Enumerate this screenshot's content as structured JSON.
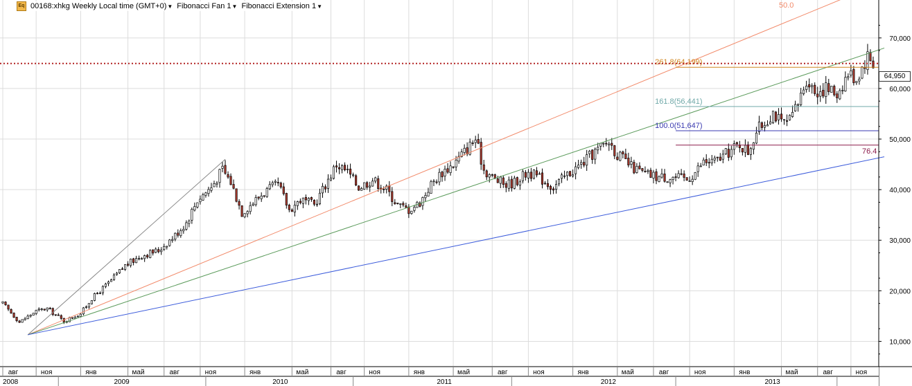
{
  "header": {
    "symbol_label": "00168:xhkg Weekly Local time (GMT+0)",
    "tool1_label": "Fibonacci Fan 1",
    "tool2_label": "Fibonacci Extension 1",
    "icon": "eq-icon"
  },
  "last_price_label": "64,950",
  "colors": {
    "up": "#ffffff",
    "down": "#b03a2e",
    "wick": "#000000",
    "fan_50": "#f28a6a",
    "fan_upper": "#5a9a5a",
    "fan_lower": "#3b5bdb",
    "ext_261": "#d0851e",
    "ext_161": "#6fa8a8",
    "ext_100": "#3a3ab0",
    "ext_76": "#8b1a4a",
    "price_line": "#b22222",
    "grid": "#dcdcdc"
  },
  "chart_data": {
    "type": "candlestick",
    "title": "",
    "y_ticks": [
      "10,000",
      "20,000",
      "30,000",
      "40,000",
      "50,000",
      "60,000",
      "70,000"
    ],
    "y_tick_values": [
      10000,
      20000,
      30000,
      40000,
      50000,
      60000,
      70000
    ],
    "ylim": [
      5000,
      77500
    ],
    "y_axis_side": "right",
    "last_price": 64950,
    "x_month_labels": [
      "авг",
      "ноя",
      "янв",
      "май",
      "авг",
      "ноя",
      "янв",
      "май",
      "авг",
      "ноя",
      "янв",
      "май",
      "авг",
      "ноя",
      "янв",
      "май",
      "авг",
      "ноя",
      "янв",
      "май",
      "авг",
      "ноя"
    ],
    "x_month_index": [
      0,
      12,
      28,
      45,
      58,
      71,
      87,
      104,
      118,
      130,
      146,
      162,
      176,
      189,
      205,
      221,
      234,
      247,
      263,
      280,
      293,
      305
    ],
    "x_year_labels": [
      "2008",
      "2009",
      "2010",
      "2011",
      "2012",
      "2013"
    ],
    "x_year_index": [
      9,
      49,
      106,
      165,
      224,
      283
    ],
    "x_year_starts": [
      -5,
      20,
      73,
      126,
      183,
      242,
      300
    ],
    "weeks": 315,
    "close_anchors": [
      [
        0,
        17500
      ],
      [
        6,
        13800
      ],
      [
        12,
        16000
      ],
      [
        16,
        16500
      ],
      [
        22,
        14000
      ],
      [
        28,
        15500
      ],
      [
        32,
        18500
      ],
      [
        38,
        21500
      ],
      [
        44,
        25000
      ],
      [
        50,
        27000
      ],
      [
        56,
        28000
      ],
      [
        62,
        31000
      ],
      [
        66,
        33500
      ],
      [
        70,
        38000
      ],
      [
        75,
        40500
      ],
      [
        79,
        44000
      ],
      [
        82,
        41500
      ],
      [
        86,
        35500
      ],
      [
        90,
        37500
      ],
      [
        94,
        39500
      ],
      [
        99,
        41000
      ],
      [
        103,
        36000
      ],
      [
        107,
        38000
      ],
      [
        112,
        37000
      ],
      [
        116,
        41000
      ],
      [
        120,
        45000
      ],
      [
        124,
        43500
      ],
      [
        128,
        40500
      ],
      [
        133,
        42000
      ],
      [
        138,
        40000
      ],
      [
        142,
        37000
      ],
      [
        146,
        36000
      ],
      [
        150,
        37500
      ],
      [
        154,
        41000
      ],
      [
        158,
        43500
      ],
      [
        162,
        45000
      ],
      [
        166,
        47500
      ],
      [
        170,
        50000
      ],
      [
        173,
        44000
      ],
      [
        177,
        42000
      ],
      [
        181,
        41000
      ],
      [
        184,
        41500
      ],
      [
        189,
        43500
      ],
      [
        194,
        42000
      ],
      [
        198,
        40500
      ],
      [
        203,
        43000
      ],
      [
        208,
        45000
      ],
      [
        213,
        47500
      ],
      [
        218,
        49500
      ],
      [
        221,
        47000
      ],
      [
        226,
        44500
      ],
      [
        231,
        43000
      ],
      [
        236,
        42500
      ],
      [
        241,
        42500
      ],
      [
        246,
        42000
      ],
      [
        249,
        43500
      ],
      [
        252,
        45500
      ],
      [
        256,
        45500
      ],
      [
        260,
        47000
      ],
      [
        265,
        49000
      ],
      [
        268,
        47500
      ],
      [
        271,
        51500
      ],
      [
        275,
        54000
      ],
      [
        277,
        55500
      ],
      [
        280,
        53000
      ],
      [
        283,
        53500
      ],
      [
        286,
        57000
      ],
      [
        289,
        62000
      ],
      [
        292,
        59500
      ],
      [
        296,
        60000
      ],
      [
        300,
        59000
      ],
      [
        304,
        63000
      ],
      [
        307,
        62000
      ],
      [
        311,
        66500
      ],
      [
        313,
        64950
      ]
    ],
    "fib_fan": {
      "label": "Fibonacci Fan 1",
      "origin": {
        "week": 9,
        "price": 11300
      },
      "pivot": {
        "week": 80,
        "price": 46000
      },
      "levels": [
        {
          "name": "0",
          "end_week": 80,
          "end_price": 46000
        },
        {
          "name": "50.0",
          "end_week": 312,
          "end_price": 80000
        },
        {
          "name": "upper",
          "end_week": 317,
          "end_price": 68000
        },
        {
          "name": "lower",
          "end_week": 317,
          "end_price": 46500
        }
      ],
      "label_50": "50.0"
    },
    "fib_extension": {
      "label": "Fibonacci Extension 1",
      "levels": [
        {
          "ratio": "261.8",
          "price": 64199,
          "label": "261.8(64,199)"
        },
        {
          "ratio": "161.8",
          "price": 56441,
          "label": "161.8(56,441)"
        },
        {
          "ratio": "100.0",
          "price": 51647,
          "label": "100.0(51,647)"
        },
        {
          "ratio": "76.4",
          "price": 48800,
          "label": "76.4"
        }
      ],
      "start_week": 242
    }
  }
}
